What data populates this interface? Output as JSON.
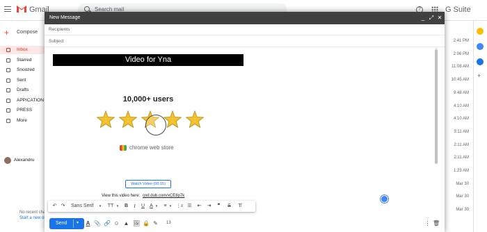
{
  "app": {
    "name": "Gmail",
    "search_placeholder": "Search mail",
    "gsuite_label": "G Suite",
    "help_symbol": "?"
  },
  "sidebar": {
    "compose_label": "Compose",
    "items": [
      {
        "label": "Inbox",
        "active": true
      },
      {
        "label": "Starred"
      },
      {
        "label": "Snoozed"
      },
      {
        "label": "Sent"
      },
      {
        "label": "Drafts"
      },
      {
        "label": "APPICATION"
      },
      {
        "label": "PRESS"
      },
      {
        "label": "More"
      }
    ],
    "user_name": "Alexandru",
    "no_recent_chats": "No recent chats",
    "start_new": "Start a new one"
  },
  "inbox_times": [
    "2:41 PM",
    "2:06 PM",
    "11:08 AM",
    "10:45 AM",
    "9:48 AM",
    "4:10 AM",
    "4:10 AM",
    "3:11 AM",
    "2:11 AM",
    "2:11 AM",
    "1:23 AM",
    "Mar 30",
    "Mar 30",
    "Mar 30"
  ],
  "compose": {
    "title": "New Message",
    "minimize_symbol": "_",
    "expand_symbol": "⤢",
    "close_symbol": "✕",
    "recipients_label": "Recipients",
    "subject_label": "Subject",
    "video_title": "Video for Yna",
    "users_text": "10,000+ users",
    "stars_filled": 5,
    "store_label": "chrome web store",
    "watch_button": "Watch Video (00:15)",
    "view_text": "View this video here:",
    "view_link": "cnd.dub.com/xCE8p7k",
    "send_label": "Send",
    "page_count": "13"
  },
  "format_toolbar": {
    "undo": "↶",
    "redo": "↷",
    "font": "Sans Serif",
    "size_icon": "TT",
    "bold": "B",
    "italic": "I",
    "underline": "U",
    "text_color": "A",
    "align": "≡",
    "numbered_list": "⋮≡",
    "bulleted_list": "☰",
    "indent_less": "⇤",
    "indent_more": "⇥",
    "quote": "❞",
    "strikethrough": "S",
    "clear_format": "T̸"
  },
  "bottom_icons": [
    "A",
    "📎",
    "🔗",
    "☺",
    "▲",
    "🖼",
    "🔒",
    "✎"
  ],
  "colors": {
    "accent": "#1a73e8",
    "header": "#404040",
    "star": "#f2c230",
    "inbox_active": "#d93025"
  }
}
